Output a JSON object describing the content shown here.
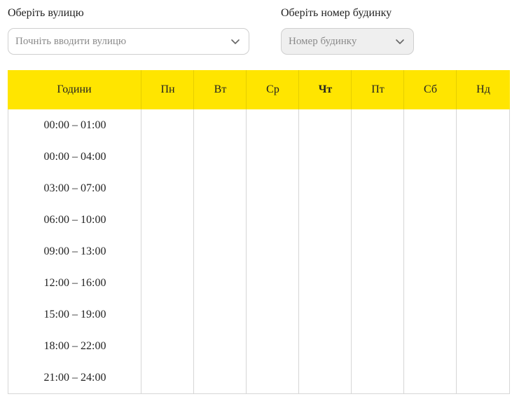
{
  "street_field": {
    "label": "Оберіть вулицю",
    "placeholder": "Почніть вводити вулицю"
  },
  "house_field": {
    "label": "Оберіть номер будинку",
    "placeholder": "Номер будинку",
    "disabled": true
  },
  "schedule": {
    "hours_header": "Години",
    "days": [
      "Пн",
      "Вт",
      "Ср",
      "Чт",
      "Пт",
      "Сб",
      "Нд"
    ],
    "today": "Чт",
    "hours": [
      "00:00 – 01:00",
      "00:00 – 04:00",
      "03:00 – 07:00",
      "06:00 – 10:00",
      "09:00 – 13:00",
      "12:00 – 16:00",
      "15:00 – 19:00",
      "18:00 – 22:00",
      "21:00 – 24:00"
    ]
  },
  "colors": {
    "header_bg": "#ffe500",
    "border": "#d6d6d6",
    "placeholder_text": "#8a8a8a",
    "disabled_bg": "#efefef"
  },
  "icons": {
    "dropdown": "chevron-down-icon"
  }
}
